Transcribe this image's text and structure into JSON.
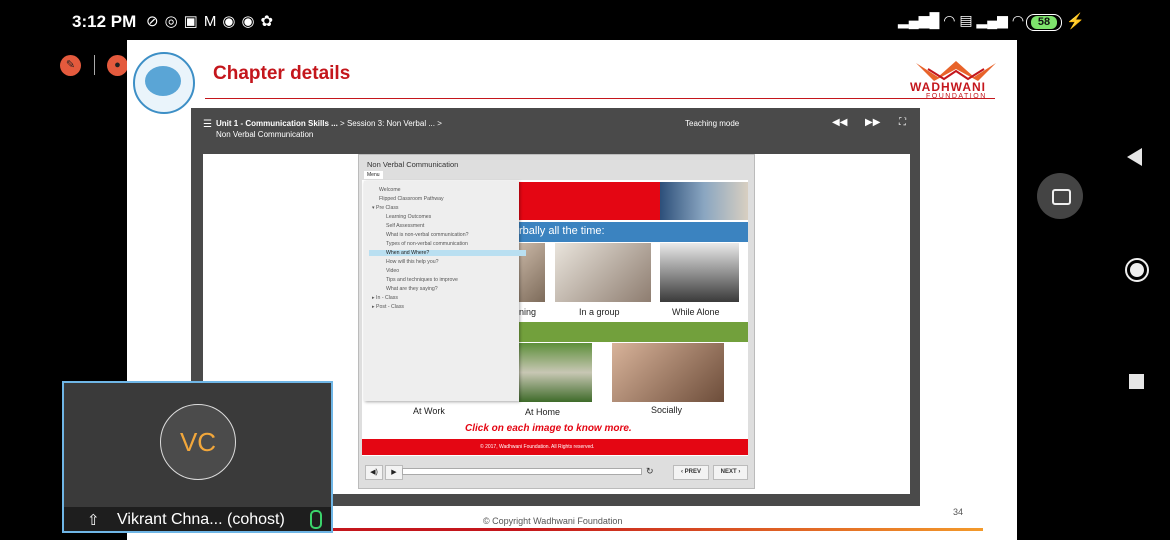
{
  "status_bar": {
    "time": "3:12 PM",
    "battery": "58",
    "app_icons": [
      "chain-icon",
      "whatsapp-icon",
      "screen-icon",
      "m-icon",
      "chrome-icon",
      "chrome-icon",
      "game-icon"
    ]
  },
  "slide": {
    "title": "Chapter details",
    "brand_name": "WADHWANI",
    "brand_sub": "FOUNDATION",
    "page_number": "34",
    "copyright": "© Copyright Wadhwani Foundation",
    "accent_color": "#c4161c"
  },
  "player": {
    "breadcrumb": {
      "unit": "Unit 1 - Communication Skills ...",
      "sep1": ">",
      "session": "Session 3: Non Verbal ...",
      "sep2": ">",
      "page": "Non Verbal Communication"
    },
    "mode_label": "Teaching mode",
    "module": {
      "title": "Non Verbal Communication",
      "menu_tab": "Menu",
      "banner_text": "rbally all the time:",
      "click_prompt": "Click on each image to know more.",
      "footer_text": "© 2017, Wadhwani Foundation. All Rights reserved.",
      "prev_label": "‹ PREV",
      "next_label": "NEXT ›",
      "image_labels": {
        "meeting": "ning",
        "group": "In a group",
        "alone": "While Alone",
        "work": "At Work",
        "home": "At Home",
        "social": "Socially"
      },
      "menu_items": [
        {
          "label": "Welcome",
          "level": 1
        },
        {
          "label": "Flipped Classroom Pathway",
          "level": 1
        },
        {
          "label": "▾  Pre Class",
          "level": 1
        },
        {
          "label": "Learning Outcomes",
          "level": 2
        },
        {
          "label": "Self Assessment",
          "level": 2
        },
        {
          "label": "What is non-verbal communication?",
          "level": 2
        },
        {
          "label": "Types of non-verbal communication",
          "level": 2
        },
        {
          "label": "When and Where?",
          "level": 2,
          "selected": true
        },
        {
          "label": "How will this help you?",
          "level": 2
        },
        {
          "label": "Video",
          "level": 2
        },
        {
          "label": "Tips and techniques to improve",
          "level": 2
        },
        {
          "label": "What are they saying?",
          "level": 2
        },
        {
          "label": "▸  In - Class",
          "level": 1
        },
        {
          "label": "▸  Post - Class",
          "level": 1
        }
      ]
    }
  },
  "participant": {
    "initials": "VC",
    "name": "Vikrant Chna... (cohost)"
  }
}
